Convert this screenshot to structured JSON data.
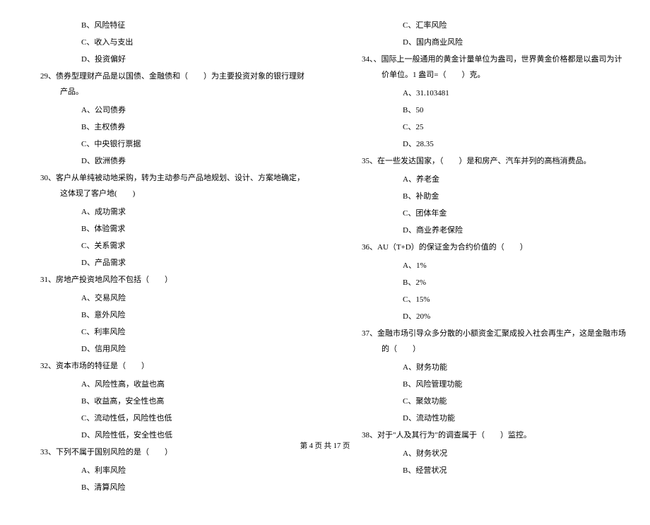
{
  "left": {
    "opts_pre": [
      {
        "label": "B",
        "text": "风险特征"
      },
      {
        "label": "C",
        "text": "收入与支出"
      },
      {
        "label": "D",
        "text": "投资偏好"
      }
    ],
    "q29": {
      "num": "29、",
      "text": "债券型理财产品是以国债、金融债和（　　）为主要投资对象的银行理财产品。",
      "options": [
        {
          "label": "A",
          "text": "公司债券"
        },
        {
          "label": "B",
          "text": "主权债券"
        },
        {
          "label": "C",
          "text": "中央银行票据"
        },
        {
          "label": "D",
          "text": "欧洲债券"
        }
      ]
    },
    "q30": {
      "num": "30、",
      "text": "客户从单纯被动地采购，转为主动参与产品地规划、设计、方案地确定，这体现了客户地(　　)",
      "options": [
        {
          "label": "A",
          "text": "成功需求"
        },
        {
          "label": "B",
          "text": "体验需求"
        },
        {
          "label": "C",
          "text": "关系需求"
        },
        {
          "label": "D",
          "text": "产品需求"
        }
      ]
    },
    "q31": {
      "num": "31、",
      "text": "房地产投资地风险不包括（　　）",
      "options": [
        {
          "label": "A",
          "text": "交易风险"
        },
        {
          "label": "B",
          "text": "意外风险"
        },
        {
          "label": "C",
          "text": "利率风险"
        },
        {
          "label": "D",
          "text": "信用风险"
        }
      ]
    },
    "q32": {
      "num": "32、",
      "text": "资本市场的特征是（　　）",
      "options": [
        {
          "label": "A",
          "text": "风险性高，收益也高"
        },
        {
          "label": "B",
          "text": "收益高，安全性也高"
        },
        {
          "label": "C",
          "text": "流动性低，风险性也低"
        },
        {
          "label": "D",
          "text": "风险性低，安全性也低"
        }
      ]
    },
    "q33": {
      "num": "33、",
      "text": "下列不属于国别风险的是（　　）",
      "options": [
        {
          "label": "A",
          "text": "利率风险"
        },
        {
          "label": "B",
          "text": "清算风险"
        }
      ]
    }
  },
  "right": {
    "opts_pre": [
      {
        "label": "C",
        "text": "汇率风险"
      },
      {
        "label": "D",
        "text": "国内商业风险"
      }
    ],
    "q34": {
      "num": "34、",
      "text": "、国际上一般通用的黄金计量单位为盎司，世界黄金价格都是以盎司为计价单位。1 盎司=（　　）克。",
      "options": [
        {
          "label": "A",
          "text": "31.103481"
        },
        {
          "label": "B",
          "text": "50"
        },
        {
          "label": "C",
          "text": "25"
        },
        {
          "label": "D",
          "text": "28.35"
        }
      ]
    },
    "q35": {
      "num": "35、",
      "text": "在一些发达国家，（　　）是和房产、汽车并列的高档消费品。",
      "options": [
        {
          "label": "A",
          "text": "养老金"
        },
        {
          "label": "B",
          "text": "补助金"
        },
        {
          "label": "C",
          "text": "团体年金"
        },
        {
          "label": "D",
          "text": "商业养老保险"
        }
      ]
    },
    "q36": {
      "num": "36、",
      "text": "AU（T+D）的保证金为合约价值的（　　）",
      "options": [
        {
          "label": "A",
          "text": "1%"
        },
        {
          "label": "B",
          "text": "2%"
        },
        {
          "label": "C",
          "text": "15%"
        },
        {
          "label": "D",
          "text": "20%"
        }
      ]
    },
    "q37": {
      "num": "37、",
      "text": "金融市场引导众多分散的小额资金汇聚成投入社会再生产，这是金融市场的（　　）",
      "options": [
        {
          "label": "A",
          "text": "财务功能"
        },
        {
          "label": "B",
          "text": "风险管理功能"
        },
        {
          "label": "C",
          "text": "聚敛功能"
        },
        {
          "label": "D",
          "text": "流动性功能"
        }
      ]
    },
    "q38": {
      "num": "38、",
      "text": "对于\"人及其行为\"的调查属于（　　）监控。",
      "options": [
        {
          "label": "A",
          "text": "财务状况"
        },
        {
          "label": "B",
          "text": "经营状况"
        }
      ]
    }
  },
  "footer": "第 4 页 共 17 页"
}
